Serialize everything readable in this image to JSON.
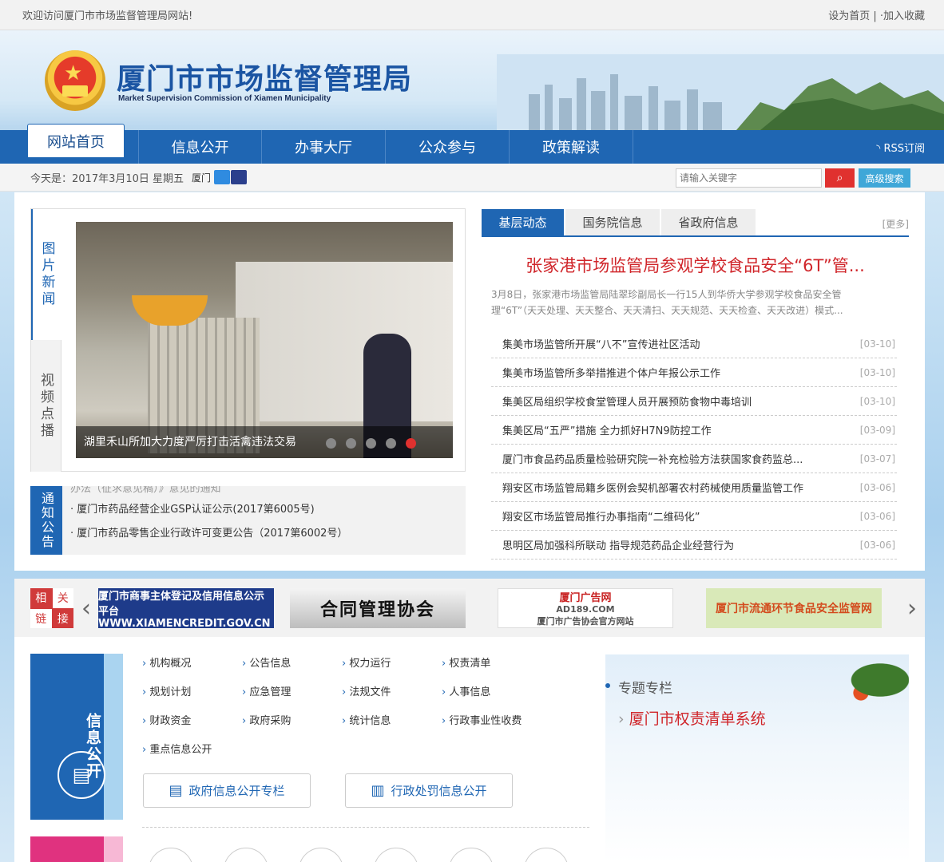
{
  "topbar": {
    "welcome": "欢迎访问厦门市市场监督管理局网站!",
    "set_home": "设为首页",
    "sep": " | ",
    "favorite": "·加入收藏"
  },
  "header": {
    "title": "厦门市市场监督管理局",
    "subtitle": "Market Supervision Commission of Xiamen Municipality"
  },
  "nav": {
    "home": "网站首页",
    "items": [
      "信息公开",
      "办事大厅",
      "公众参与",
      "政策解读"
    ],
    "rss": "RSS订阅"
  },
  "infobar": {
    "date": "今天是：2017年3月10日 星期五",
    "city": "厦门",
    "search_placeholder": "请输入关键字",
    "advanced": "高级搜索"
  },
  "photo_news": {
    "tabs": [
      "图片新闻",
      "视频点播"
    ],
    "caption": "湖里禾山所加大力度严厉打击活禽违法交易",
    "slides": 5,
    "active_slide": 5
  },
  "notice": {
    "tag": "通知公告",
    "ghost": "办法（征求意见稿）》意见的通知",
    "items": [
      "· 厦门市药品经营企业GSP认证公示(2017第6005号)",
      "· 厦门市药品零售企业行政许可变更公告（2017第6002号）"
    ]
  },
  "news": {
    "tabs": [
      "基层动态",
      "国务院信息",
      "省政府信息"
    ],
    "more": "[更多]",
    "headline": "张家港市场监管局参观学校食品安全“6T”管...",
    "summary": "3月8日，张家港市场监管局陆翠珍副局长一行15人到华侨大学参观学校食品安全管理“6T”（天天处理、天天整合、天天清扫、天天规范、天天检查、天天改进）模式...",
    "items": [
      {
        "title": "集美市场监管所开展“八不”宣传进社区活动",
        "date": "[03-10]"
      },
      {
        "title": "集美市场监管所多举措推进个体户年报公示工作",
        "date": "[03-10]"
      },
      {
        "title": "集美区局组织学校食堂管理人员开展预防食物中毒培训",
        "date": "[03-10]"
      },
      {
        "title": "集美区局“五严”措施 全力抓好H7N9防控工作",
        "date": "[03-09]"
      },
      {
        "title": "厦门市食品药品质量检验研究院一补充检验方法获国家食药监总...",
        "date": "[03-07]"
      },
      {
        "title": "翔安区市场监管局籍乡医例会契机部署农村药械使用质量监管工作",
        "date": "[03-06]"
      },
      {
        "title": "翔安区市场监管局推行办事指南“二维码化”",
        "date": "[03-06]"
      },
      {
        "title": "思明区局加强科所联动 指导规范药品企业经营行为",
        "date": "[03-06]"
      }
    ]
  },
  "links": {
    "tag": [
      "相",
      "关",
      "链",
      "接"
    ],
    "logos": [
      "厦门市商事主体登记及信用信息公示平台 WWW.XIAMENCREDIT.GOV.CN",
      "合同管理协会",
      "厦门广告网",
      "AD189.COM",
      "厦门市广告协会官方网站",
      "厦门市流通环节食品安全监管网"
    ]
  },
  "info_public": {
    "label": "信息公开",
    "items": [
      "机构概况",
      "公告信息",
      "权力运行",
      "权责清单",
      "规划计划",
      "应急管理",
      "法规文件",
      "人事信息",
      "财政资金",
      "政府采购",
      "统计信息",
      "行政事业性收费",
      "重点信息公开"
    ],
    "btn1": "政府信息公开专栏",
    "btn2": "行政处罚信息公开"
  },
  "special": {
    "heading": "专题专栏",
    "link": "厦门市权责清单系统"
  },
  "colors": {
    "primary": "#1f66b3",
    "accent": "#d0252a",
    "pink": "#e0327f"
  }
}
